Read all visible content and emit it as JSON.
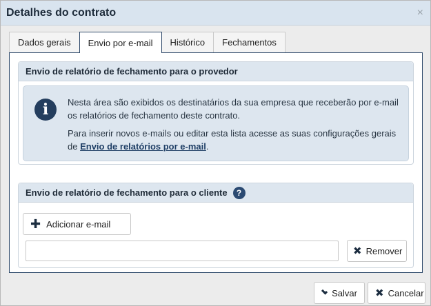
{
  "dialog": {
    "title": "Detalhes do contrato",
    "close_symbol": "×"
  },
  "tabs": [
    {
      "label": "Dados gerais",
      "active": false
    },
    {
      "label": "Envio por e-mail",
      "active": true
    },
    {
      "label": "Histórico",
      "active": false
    },
    {
      "label": "Fechamentos",
      "active": false
    }
  ],
  "provider_section": {
    "title": "Envio de relatório de fechamento para o provedor",
    "info_icon": "info-icon",
    "paragraph1": "Nesta área são exibidos os destinatários da sua empresa que receberão por e-mail os relatórios de fechamento deste contrato.",
    "paragraph2": "Para inserir novos e-mails ou editar esta lista acesse as suas configurações gerais de",
    "link_text": "Envio de relatórios por e-mail",
    "link_suffix": "."
  },
  "client_section": {
    "title": "Envio de relatório de fechamento para o cliente",
    "help_icon": "question-circle-icon",
    "help_symbol": "?",
    "add_button_label": "Adicionar e-mail",
    "email_value": "",
    "remove_button_label": "Remover"
  },
  "footer": {
    "save_label": "Salvar",
    "cancel_label": "Cancelar"
  },
  "colors": {
    "accent": "#2f4a6b",
    "header_bg": "#d9e4ef",
    "info_bg": "#dde6ef",
    "icon_dark": "#243e5e"
  }
}
